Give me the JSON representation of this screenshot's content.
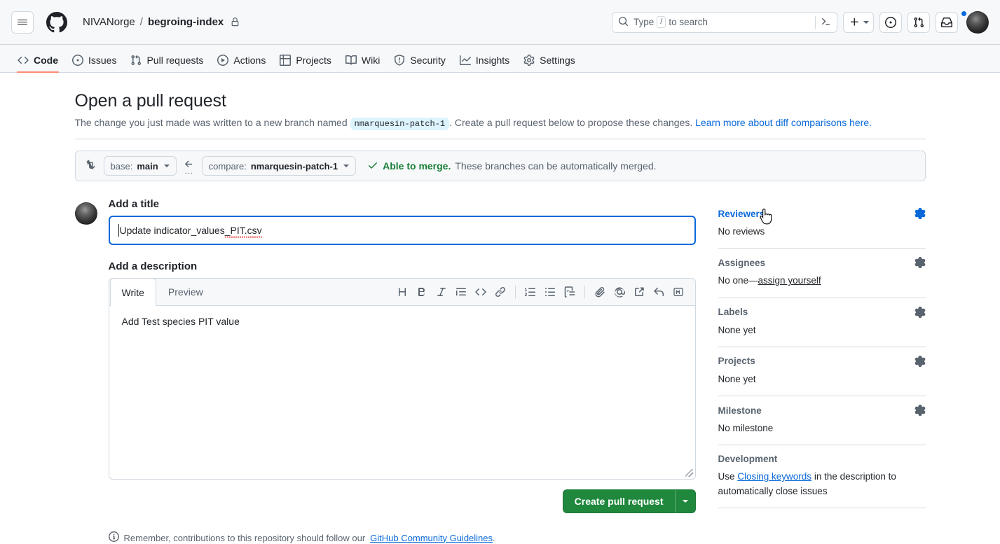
{
  "header": {
    "menu_icon": "hamburger-icon",
    "logo_icon": "github-logo-icon",
    "owner": "NIVANorge",
    "separator": "/",
    "repo": "begroing-index",
    "private_icon": "lock-icon",
    "search_placeholder_before": "Type",
    "search_key": "/",
    "search_placeholder_after": "to search",
    "search_icon": "search-icon",
    "terminal_icon": "command-palette-icon",
    "create_new_icon": "plus-icon",
    "issues_icon": "issue-opened-icon",
    "pull_requests_icon": "git-pull-request-icon",
    "inbox_icon": "inbox-icon",
    "avatar_icon": "user-avatar"
  },
  "repo_nav": {
    "tabs": [
      {
        "label": "Code",
        "icon": "code-icon",
        "active": true
      },
      {
        "label": "Issues",
        "icon": "issue-opened-icon",
        "active": false
      },
      {
        "label": "Pull requests",
        "icon": "git-pull-request-icon",
        "active": false
      },
      {
        "label": "Actions",
        "icon": "play-icon",
        "active": false
      },
      {
        "label": "Projects",
        "icon": "table-icon",
        "active": false
      },
      {
        "label": "Wiki",
        "icon": "book-icon",
        "active": false
      },
      {
        "label": "Security",
        "icon": "shield-icon",
        "active": false
      },
      {
        "label": "Insights",
        "icon": "graph-icon",
        "active": false
      },
      {
        "label": "Settings",
        "icon": "gear-icon",
        "active": false
      }
    ],
    "active_underline_color": "#fd8c73"
  },
  "page": {
    "title": "Open a pull request",
    "subtitle_part1": "The change you just made was written to a new branch named",
    "branch_pill": "nmarquesin-patch-1",
    "subtitle_part2": ". Create a pull request below to propose these changes.",
    "subtitle_link": "Learn more about diff comparisons here."
  },
  "compare_bar": {
    "compare_icon": "git-compare-icon",
    "base_prefix": "base:",
    "base_branch": "main",
    "arrow_icon": "arrow-left-icon",
    "dots": "...",
    "compare_prefix": "compare:",
    "compare_branch": "nmarquesin-patch-1",
    "check_icon": "check-icon",
    "merge_status": "Able to merge.",
    "merge_detail": "These branches can be automatically merged.",
    "merge_color": "#1a7f37"
  },
  "form": {
    "title_label": "Add a title",
    "title_value": "Update indicator_values",
    "title_value_misspelled": "_PIT.csv",
    "description_label": "Add a description",
    "tabs": [
      {
        "label": "Write",
        "active": true
      },
      {
        "label": "Preview",
        "active": false
      }
    ],
    "toolbar": [
      {
        "icon": "heading-icon",
        "name": "heading-button"
      },
      {
        "icon": "bold-icon",
        "name": "bold-button"
      },
      {
        "icon": "italic-icon",
        "name": "italic-button"
      },
      {
        "icon": "quote-icon",
        "name": "quote-button"
      },
      {
        "icon": "code-icon",
        "name": "code-button"
      },
      {
        "icon": "link-icon",
        "name": "link-button"
      },
      {
        "icon": "ordered-list-icon",
        "name": "numbered-list-button"
      },
      {
        "icon": "unordered-list-icon",
        "name": "bulleted-list-button"
      },
      {
        "icon": "tasklist-icon",
        "name": "task-list-button"
      },
      {
        "icon": "paperclip-icon",
        "name": "attach-files-button"
      },
      {
        "icon": "mention-icon",
        "name": "mention-button"
      },
      {
        "icon": "cross-reference-icon",
        "name": "reference-button"
      },
      {
        "icon": "reply-icon",
        "name": "saved-replies-button"
      },
      {
        "icon": "markdown-icon",
        "name": "markdown-button"
      }
    ],
    "description_value": "Add Test species PIT value",
    "submit_label": "Create pull request",
    "submit_color": "#1f883d",
    "footnote_icon": "info-icon",
    "footnote_text": "Remember, contributions to this repository should follow our",
    "footnote_link": "GitHub Community Guidelines",
    "footnote_period": "."
  },
  "sidebar": {
    "sections": [
      {
        "title": "Reviewers",
        "highlighted": true,
        "gear": true,
        "body": "No reviews",
        "body_link": null,
        "body_after": null
      },
      {
        "title": "Assignees",
        "highlighted": false,
        "gear": true,
        "body": "No one—",
        "body_link": "assign yourself",
        "body_after": null
      },
      {
        "title": "Labels",
        "highlighted": false,
        "gear": true,
        "body": "None yet",
        "body_link": null,
        "body_after": null
      },
      {
        "title": "Projects",
        "highlighted": false,
        "gear": true,
        "body": "None yet",
        "body_link": null,
        "body_after": null
      },
      {
        "title": "Milestone",
        "highlighted": false,
        "gear": true,
        "body": "No milestone",
        "body_link": null,
        "body_after": null
      },
      {
        "title": "Development",
        "highlighted": false,
        "gear": false,
        "body": "Use ",
        "body_link": "Closing keywords",
        "body_after": " in the description to automatically close issues"
      }
    ],
    "gear_icon": "gear-icon"
  }
}
